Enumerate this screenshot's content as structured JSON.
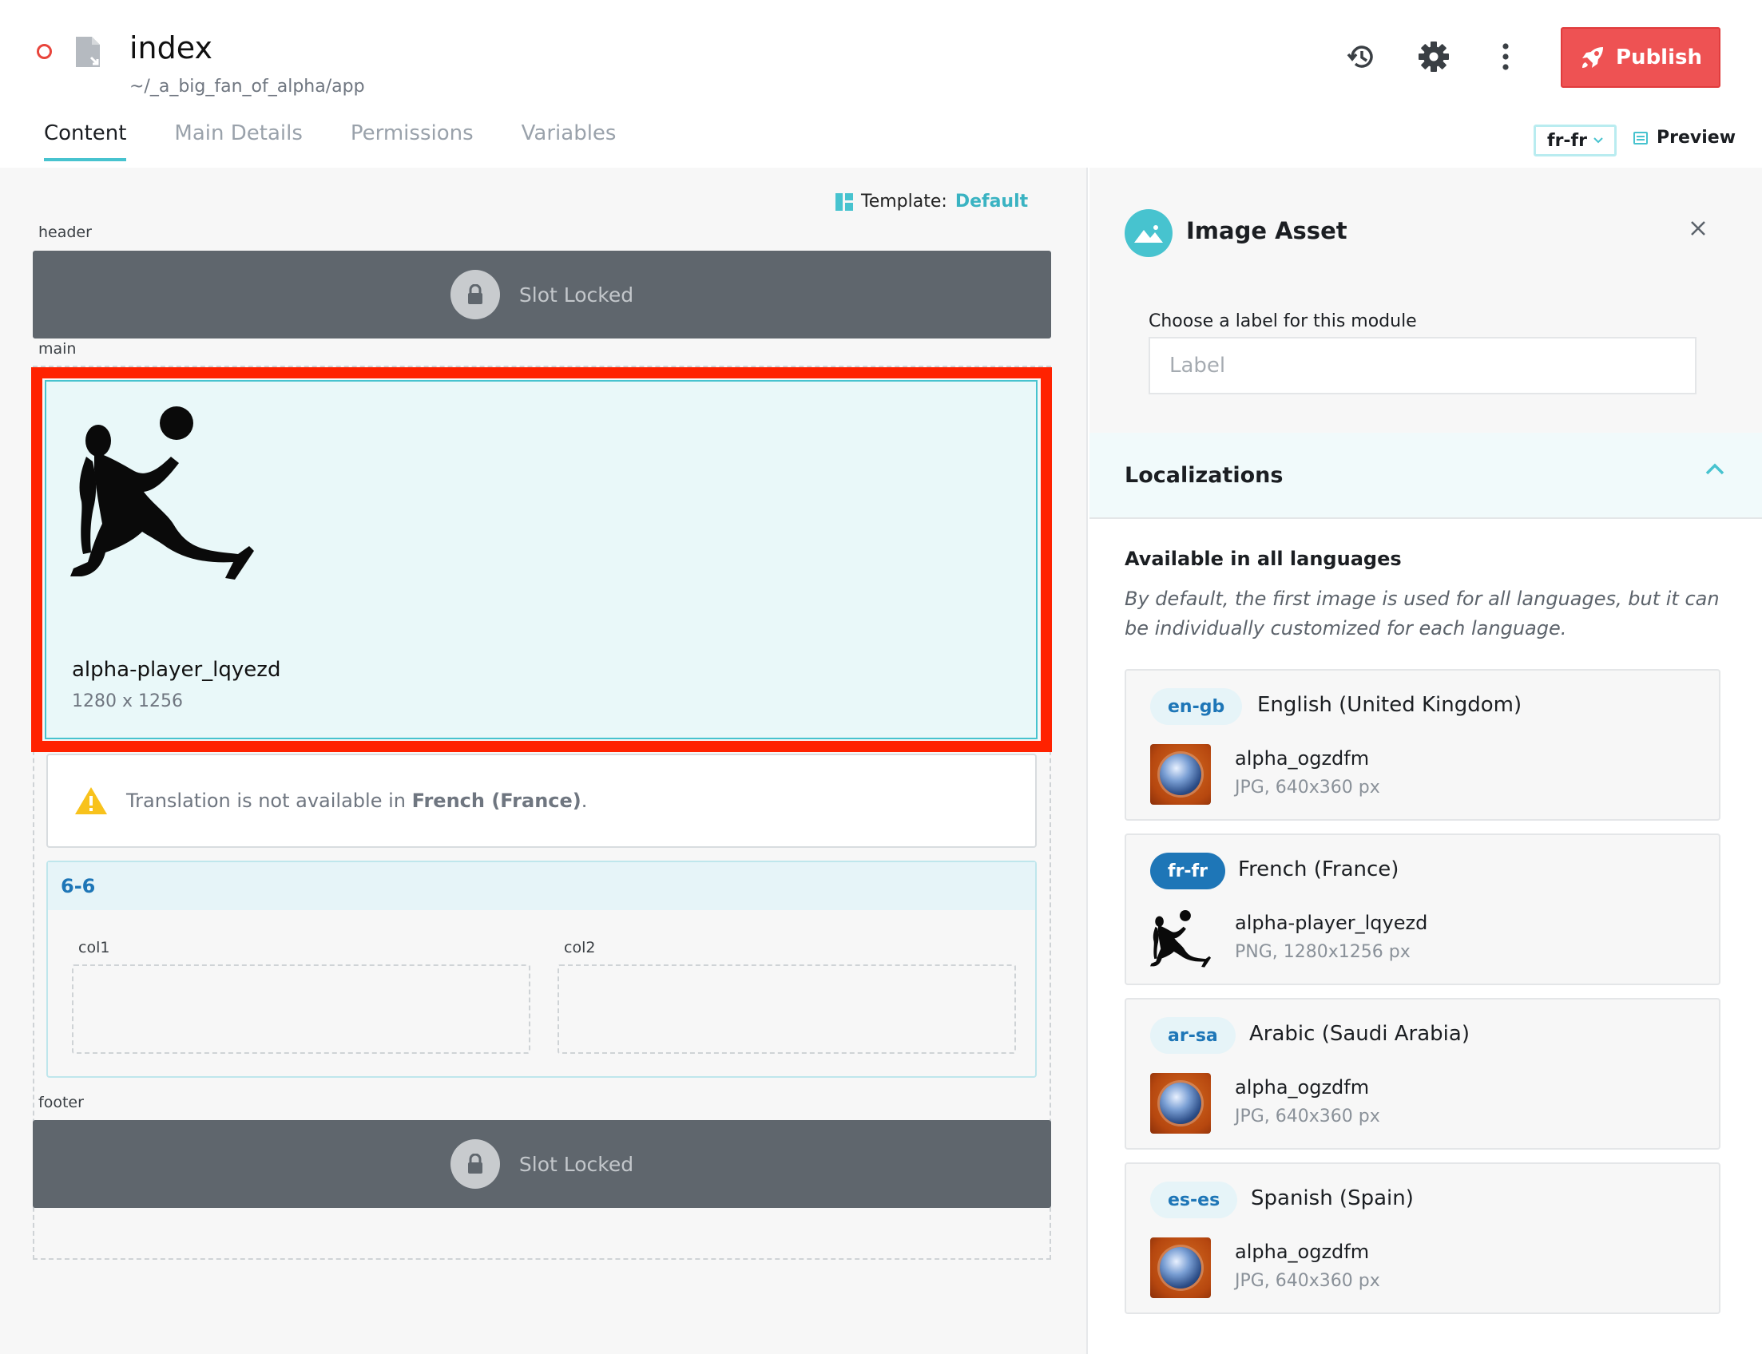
{
  "header": {
    "title": "index",
    "path": "~/_a_big_fan_of_alpha/app",
    "publish_label": "Publish",
    "tabs": [
      {
        "label": "Content",
        "active": true
      },
      {
        "label": "Main Details"
      },
      {
        "label": "Permissions"
      },
      {
        "label": "Variables"
      }
    ],
    "locale": "fr-fr",
    "preview_label": "Preview",
    "icons": [
      "history-icon",
      "gear-icon",
      "more-vertical-icon",
      "rocket-icon"
    ]
  },
  "canvas": {
    "template_label": "Template:",
    "template_value": "Default",
    "slots": {
      "header": {
        "name": "header",
        "locked_text": "Slot Locked"
      },
      "main": {
        "name": "main"
      },
      "footer": {
        "name": "footer",
        "locked_text": "Slot Locked"
      }
    },
    "image_module": {
      "name": "alpha-player_lqyezd",
      "dimensions": "1280 x 1256"
    },
    "warning": {
      "text_prefix": "Translation is not available in ",
      "language": "French (France)",
      "text_suffix": "."
    },
    "grid": {
      "title": "6-6",
      "col1": "col1",
      "col2": "col2"
    }
  },
  "panel": {
    "title": "Image Asset",
    "label_prompt": "Choose a label for this module",
    "label_placeholder": "Label",
    "localizations_title": "Localizations",
    "available_title": "Available in all languages",
    "available_desc": "By default, the first image is used for all languages, but it can be individually customized for each language.",
    "locales": [
      {
        "code": "en-gb",
        "language": "English (United Kingdom)",
        "file": "alpha_ogzdfm",
        "meta": "JPG, 640x360 px",
        "thumb": "planet",
        "active": false
      },
      {
        "code": "fr-fr",
        "language": "French (France)",
        "file": "alpha-player_lqyezd",
        "meta": "PNG, 1280x1256 px",
        "thumb": "player",
        "active": true
      },
      {
        "code": "ar-sa",
        "language": "Arabic (Saudi Arabia)",
        "file": "alpha_ogzdfm",
        "meta": "JPG, 640x360 px",
        "thumb": "planet",
        "active": false
      },
      {
        "code": "es-es",
        "language": "Spanish (Spain)",
        "file": "alpha_ogzdfm",
        "meta": "JPG, 640x360 px",
        "thumb": "planet",
        "active": false
      }
    ]
  },
  "colors": {
    "accent": "#47c3cf",
    "publish": "#ee5253",
    "selection": "#ff2200",
    "locale_blue": "#1e76b7"
  }
}
